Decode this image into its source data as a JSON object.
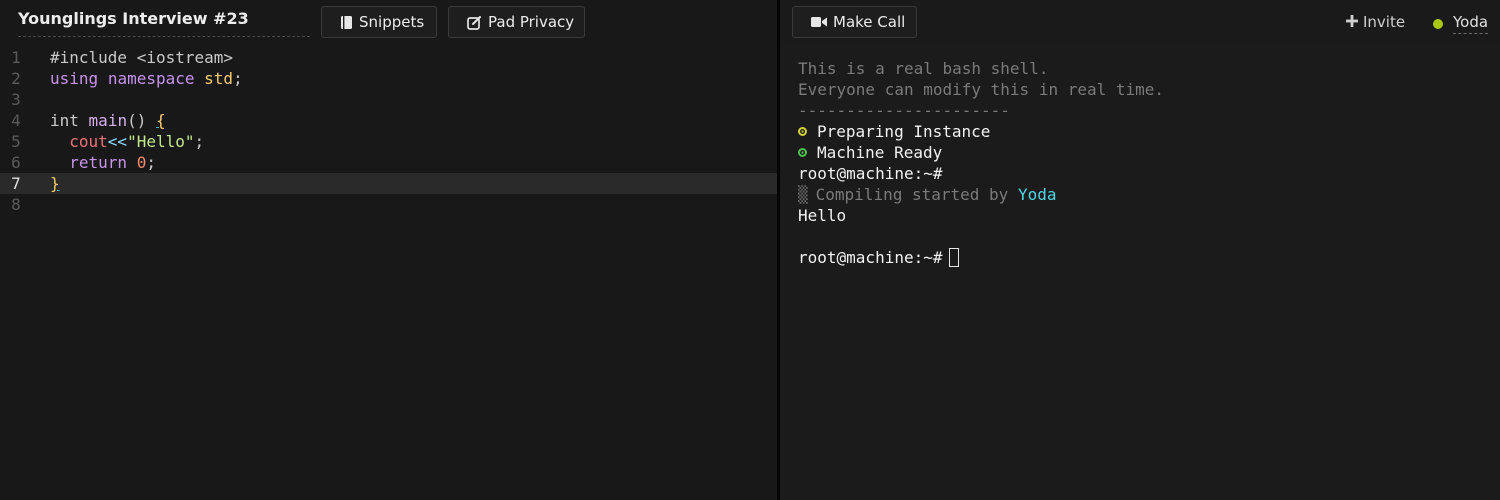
{
  "header": {
    "pad_title": "Younglings Interview #23",
    "snippets_label": "Snippets",
    "privacy_label": "Pad Privacy",
    "call_label": "Make Call",
    "invite_label": "Invite",
    "user_name": "Yoda"
  },
  "editor": {
    "active_line": 7,
    "line_numbers": [
      "1",
      "2",
      "3",
      "4",
      "5",
      "6",
      "7",
      "8"
    ],
    "lines": [
      [
        {
          "t": "#include <iostream>",
          "c": "plain"
        }
      ],
      [
        {
          "t": "using",
          "c": "kw"
        },
        {
          "t": " ",
          "c": "plain"
        },
        {
          "t": "namespace",
          "c": "kw"
        },
        {
          "t": " ",
          "c": "plain"
        },
        {
          "t": "std",
          "c": "type"
        },
        {
          "t": ";",
          "c": "punc"
        }
      ],
      [],
      [
        {
          "t": "int",
          "c": "plain"
        },
        {
          "t": " ",
          "c": "plain"
        },
        {
          "t": "main",
          "c": "fn"
        },
        {
          "t": "() ",
          "c": "plain"
        },
        {
          "t": "{",
          "c": "type",
          "u": true
        }
      ],
      [
        {
          "t": "  ",
          "c": "plain"
        },
        {
          "t": "cout",
          "c": "var"
        },
        {
          "t": "<<",
          "c": "op"
        },
        {
          "t": "\"Hello\"",
          "c": "str"
        },
        {
          "t": ";",
          "c": "punc"
        }
      ],
      [
        {
          "t": "  ",
          "c": "plain"
        },
        {
          "t": "return",
          "c": "kw"
        },
        {
          "t": " ",
          "c": "plain"
        },
        {
          "t": "0",
          "c": "num"
        },
        {
          "t": ";",
          "c": "punc"
        }
      ],
      [
        {
          "t": "}",
          "c": "type",
          "u": true
        }
      ],
      []
    ]
  },
  "terminal": {
    "intro_1": "This is a real bash shell.",
    "intro_2": "Everyone can modify this in real time.",
    "separator": "----------------------",
    "status_1": "Preparing Instance",
    "status_2": "Machine Ready",
    "prompt": "root@machine:~#",
    "compile_glyph": "▒",
    "compile_text": "Compiling started by",
    "compile_user": "Yoda",
    "output": "Hello",
    "prompt_2": "root@machine:~#"
  },
  "colors": {
    "user_dot": "#a8c80c",
    "status_preparing": "#d2d23a",
    "status_ready": "#4cc34c",
    "username_highlight": "#4fd6e6"
  },
  "icons": {
    "snippets": "snippets-icon",
    "privacy": "edit-square-icon",
    "call": "video-camera-icon",
    "invite": "plus-icon"
  }
}
